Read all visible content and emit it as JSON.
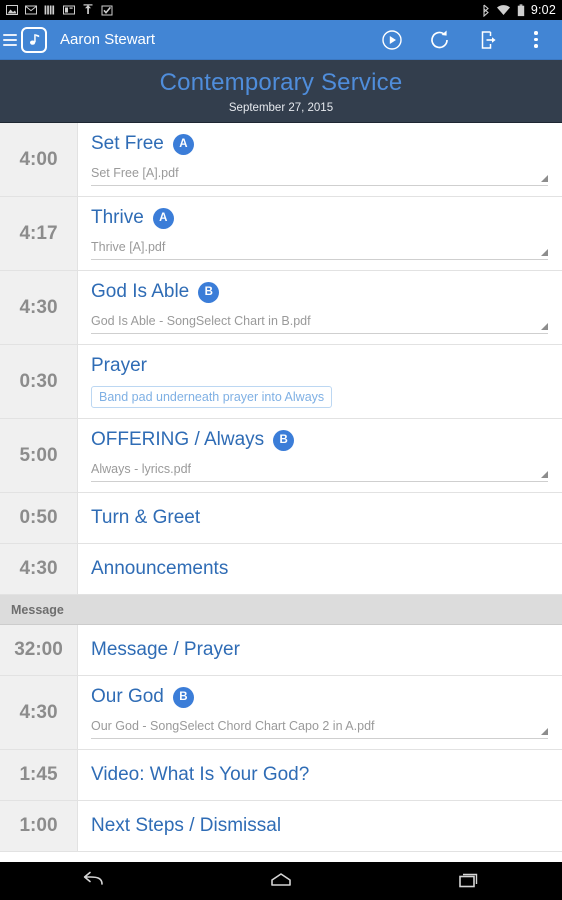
{
  "status_bar": {
    "time": "9:02",
    "left_icons": [
      "screenshot-icon",
      "mail-icon",
      "bars-icon",
      "news-icon",
      "upload-icon",
      "checkbox-icon"
    ],
    "right_icons": [
      "bluetooth-icon",
      "wifi-icon",
      "battery-icon"
    ]
  },
  "app_bar": {
    "menu_icon": "hamburger-icon",
    "logo_icon": "music-note-icon",
    "user_name": "Aaron Stewart",
    "actions": [
      {
        "name": "play-button",
        "icon": "play-circle-icon"
      },
      {
        "name": "refresh-button",
        "icon": "refresh-icon"
      },
      {
        "name": "cast-button",
        "icon": "device-export-icon"
      },
      {
        "name": "overflow-button",
        "icon": "kebab-menu-icon"
      }
    ],
    "background": "#4285d4"
  },
  "service": {
    "title": "Contemporary Service",
    "date": "September 27, 2015",
    "title_color": "#4f8ddb",
    "background": "#333e4d"
  },
  "items": [
    {
      "type": "item",
      "time": "4:00",
      "title": "Set Free",
      "key": "A",
      "file": "Set Free [A].pdf",
      "note": null
    },
    {
      "type": "item",
      "time": "4:17",
      "title": "Thrive",
      "key": "A",
      "file": "Thrive [A].pdf",
      "note": null
    },
    {
      "type": "item",
      "time": "4:30",
      "title": "God Is Able",
      "key": "B",
      "file": "God Is Able - SongSelect Chart in B.pdf",
      "note": null
    },
    {
      "type": "item",
      "time": "0:30",
      "title": "Prayer",
      "key": null,
      "file": null,
      "note": "Band pad underneath prayer into Always"
    },
    {
      "type": "item",
      "time": "5:00",
      "title": "OFFERING / Always",
      "key": "B",
      "file": "Always - lyrics.pdf",
      "note": null
    },
    {
      "type": "item",
      "time": "0:50",
      "title": "Turn & Greet",
      "key": null,
      "file": null,
      "note": null
    },
    {
      "type": "item",
      "time": "4:30",
      "title": "Announcements",
      "key": null,
      "file": null,
      "note": null
    },
    {
      "type": "section",
      "label": "Message"
    },
    {
      "type": "item",
      "time": "32:00",
      "title": "Message / Prayer",
      "key": null,
      "file": null,
      "note": null
    },
    {
      "type": "item",
      "time": "4:30",
      "title": "Our God",
      "key": "B",
      "file": "Our God - SongSelect Chord Chart Capo 2 in A.pdf",
      "note": null
    },
    {
      "type": "item",
      "time": "1:45",
      "title": "Video: What Is Your God?",
      "key": null,
      "file": null,
      "note": null
    },
    {
      "type": "item",
      "time": "1:00",
      "title": "Next Steps / Dismissal",
      "key": null,
      "file": null,
      "note": null
    }
  ],
  "nav_bar": {
    "buttons": [
      {
        "name": "nav-back-button",
        "icon": "back-arrow-icon"
      },
      {
        "name": "nav-home-button",
        "icon": "home-icon"
      },
      {
        "name": "nav-recents-button",
        "icon": "recents-icon"
      }
    ]
  },
  "colors": {
    "accent": "#3b7dd8",
    "title_link": "#2f6cb5",
    "time_text": "#8c8c8c",
    "time_bg": "#f0f0f0"
  }
}
